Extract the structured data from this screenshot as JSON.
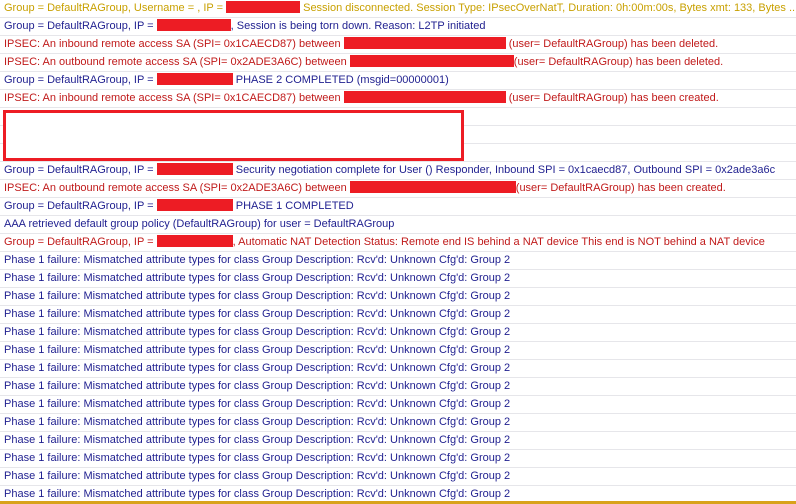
{
  "colors": {
    "warning": "#c8a000",
    "info": "#1f1f8f",
    "error": "#c01a1a",
    "redact": "#ed1c24"
  },
  "rows": [
    {
      "level": "warning",
      "segs": [
        {
          "t": "Group = DefaultRAGroup, Username = , IP = "
        },
        {
          "r": 74
        },
        {
          "t": " Session disconnected. Session Type: IPsecOverNatT, Duration: 0h:00m:00s, Bytes xmt: 133, Bytes ..."
        }
      ]
    },
    {
      "level": "info",
      "segs": [
        {
          "t": "Group = DefaultRAGroup, IP = "
        },
        {
          "r": 74
        },
        {
          "t": ", Session is being torn down. Reason: L2TP initiated"
        }
      ]
    },
    {
      "level": "error",
      "segs": [
        {
          "t": "IPSEC: An inbound remote access SA (SPI= 0x1CAECD87) between "
        },
        {
          "r": 162
        },
        {
          "t": " (user= DefaultRAGroup) has been deleted."
        }
      ]
    },
    {
      "level": "error",
      "segs": [
        {
          "t": "IPSEC: An outbound remote access SA (SPI= 0x2ADE3A6C) between "
        },
        {
          "r": 164
        },
        {
          "t": "(user= DefaultRAGroup) has been deleted."
        }
      ]
    },
    {
      "level": "info",
      "segs": [
        {
          "t": "Group = DefaultRAGroup, IP = "
        },
        {
          "r": 76
        },
        {
          "t": " PHASE 2 COMPLETED (msgid=00000001)"
        }
      ]
    },
    {
      "level": "error",
      "segs": [
        {
          "t": "IPSEC: An inbound remote access SA (SPI= 0x1CAECD87) between "
        },
        {
          "r": 162
        },
        {
          "t": " (user= DefaultRAGroup) has been created."
        }
      ]
    },
    {
      "level": "info",
      "segs": []
    },
    {
      "level": "info",
      "segs": []
    },
    {
      "level": "info",
      "segs": []
    },
    {
      "level": "info",
      "segs": [
        {
          "t": "Group = DefaultRAGroup, IP = "
        },
        {
          "r": 76
        },
        {
          "t": " Security negotiation complete for User ()  Responder, Inbound SPI = 0x1caecd87, Outbound SPI = 0x2ade3a6c"
        }
      ]
    },
    {
      "level": "error",
      "segs": [
        {
          "t": "IPSEC: An outbound remote access SA (SPI= 0x2ADE3A6C) between "
        },
        {
          "r": 166
        },
        {
          "t": "(user= DefaultRAGroup) has been created."
        }
      ]
    },
    {
      "level": "info",
      "segs": [
        {
          "t": "Group = DefaultRAGroup, IP = "
        },
        {
          "r": 76
        },
        {
          "t": " PHASE 1 COMPLETED"
        }
      ]
    },
    {
      "level": "info",
      "segs": [
        {
          "t": "AAA retrieved default group policy (DefaultRAGroup) for user = DefaultRAGroup"
        }
      ]
    },
    {
      "level": "error",
      "segs": [
        {
          "t": "Group = DefaultRAGroup, IP = "
        },
        {
          "r": 76
        },
        {
          "t": ", Automatic NAT Detection Status:     Remote end   IS   behind a NAT device     This   end is NOT behind a NAT device"
        }
      ]
    },
    {
      "level": "info",
      "segs": [
        {
          "t": "Phase 1 failure:  Mismatched attribute types for class Group Description:  Rcv'd: Unknown  Cfg'd: Group 2"
        }
      ]
    },
    {
      "level": "info",
      "segs": [
        {
          "t": "Phase 1 failure:  Mismatched attribute types for class Group Description:  Rcv'd: Unknown  Cfg'd: Group 2"
        }
      ]
    },
    {
      "level": "info",
      "segs": [
        {
          "t": "Phase 1 failure:  Mismatched attribute types for class Group Description:  Rcv'd: Unknown  Cfg'd: Group 2"
        }
      ]
    },
    {
      "level": "info",
      "segs": [
        {
          "t": "Phase 1 failure:  Mismatched attribute types for class Group Description:  Rcv'd: Unknown  Cfg'd: Group 2"
        }
      ]
    },
    {
      "level": "info",
      "segs": [
        {
          "t": "Phase 1 failure:  Mismatched attribute types for class Group Description:  Rcv'd: Unknown  Cfg'd: Group 2"
        }
      ]
    },
    {
      "level": "info",
      "segs": [
        {
          "t": "Phase 1 failure:  Mismatched attribute types for class Group Description:  Rcv'd: Unknown  Cfg'd: Group 2"
        }
      ]
    },
    {
      "level": "info",
      "segs": [
        {
          "t": "Phase 1 failure:  Mismatched attribute types for class Group Description:  Rcv'd: Unknown  Cfg'd: Group 2"
        }
      ]
    },
    {
      "level": "info",
      "segs": [
        {
          "t": "Phase 1 failure:  Mismatched attribute types for class Group Description:  Rcv'd: Unknown  Cfg'd: Group 2"
        }
      ]
    },
    {
      "level": "info",
      "segs": [
        {
          "t": "Phase 1 failure:  Mismatched attribute types for class Group Description:  Rcv'd: Unknown  Cfg'd: Group 2"
        }
      ]
    },
    {
      "level": "info",
      "segs": [
        {
          "t": "Phase 1 failure:  Mismatched attribute types for class Group Description:  Rcv'd: Unknown  Cfg'd: Group 2"
        }
      ]
    },
    {
      "level": "info",
      "segs": [
        {
          "t": "Phase 1 failure:  Mismatched attribute types for class Group Description:  Rcv'd: Unknown  Cfg'd: Group 2"
        }
      ]
    },
    {
      "level": "info",
      "segs": [
        {
          "t": "Phase 1 failure:  Mismatched attribute types for class Group Description:  Rcv'd: Unknown  Cfg'd: Group 2"
        }
      ]
    },
    {
      "level": "info",
      "segs": [
        {
          "t": "Phase 1 failure:  Mismatched attribute types for class Group Description:  Rcv'd: Unknown  Cfg'd: Group 2"
        }
      ]
    },
    {
      "level": "info",
      "segs": [
        {
          "t": "Phase 1 failure:  Mismatched attribute types for class Group Description:  Rcv'd: Unknown  Cfg'd: Group 2"
        }
      ]
    }
  ]
}
